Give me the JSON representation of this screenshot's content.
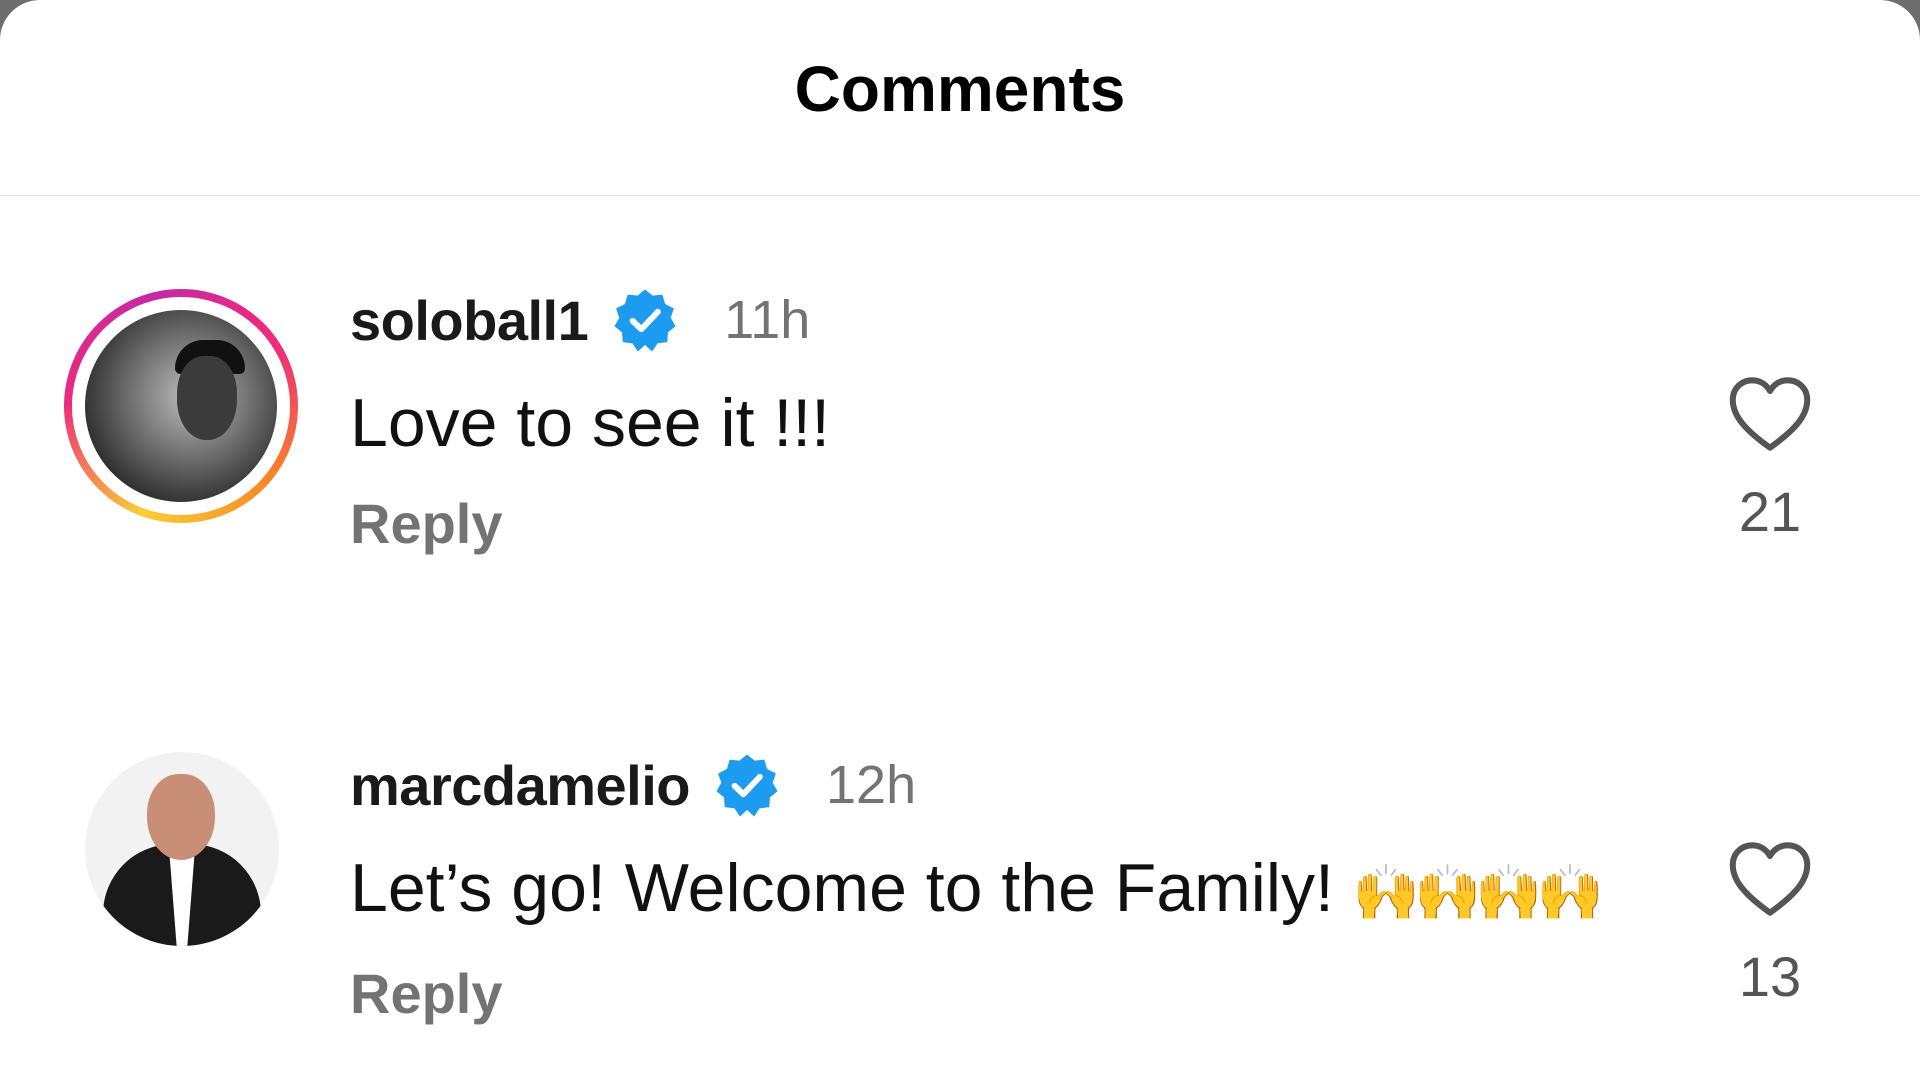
{
  "header": {
    "title": "Comments"
  },
  "comments": [
    {
      "username": "soloball1",
      "verified": true,
      "timestamp": "11h",
      "text": "Love to see it !!!",
      "emoji": "",
      "reply_label": "Reply",
      "likes": "21",
      "avatar_icon": "user-avatar-story-ring",
      "has_story_ring": true
    },
    {
      "username": "marcdamelio",
      "verified": true,
      "timestamp": "12h",
      "text": "Let’s go! Welcome to the Family! ",
      "emoji": "🙌🙌🙌🙌",
      "reply_label": "Reply",
      "likes": "13",
      "avatar_icon": "user-avatar",
      "has_story_ring": false
    }
  ],
  "icons": {
    "verified": "verified-badge-icon",
    "like": "heart-icon"
  },
  "colors": {
    "verified_blue": "#1d9bf0",
    "meta_gray": "#737373",
    "story_ring_start": "#f9ce34",
    "story_ring_end": "#c32aa3"
  }
}
